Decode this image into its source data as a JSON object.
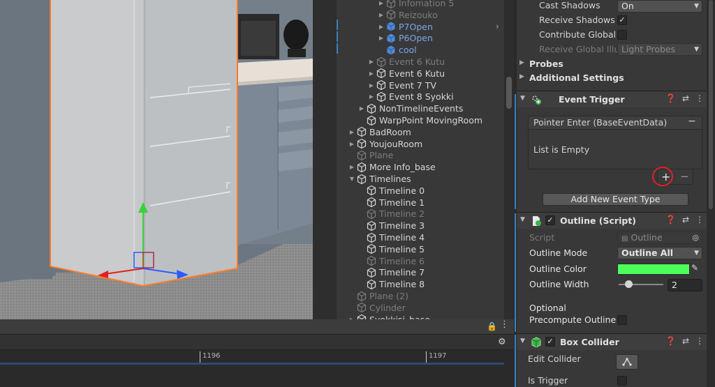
{
  "hierarchy": {
    "items": [
      {
        "label": "Infomation 5",
        "depth": 3,
        "arrow": "right",
        "state": "dim"
      },
      {
        "label": "Reizouko",
        "depth": 3,
        "arrow": "right",
        "state": "dim"
      },
      {
        "label": "P7Open",
        "depth": 3,
        "arrow": "right",
        "state": "prefab",
        "chevron": true
      },
      {
        "label": "P6Open",
        "depth": 3,
        "arrow": "right",
        "state": "prefab"
      },
      {
        "label": "cool",
        "depth": 3,
        "arrow": "",
        "state": "prefab"
      },
      {
        "label": "Event 6 Kutu",
        "depth": 2,
        "arrow": "right",
        "state": "dim"
      },
      {
        "label": "Event 6 Kutu",
        "depth": 2,
        "arrow": "right",
        "state": "normal"
      },
      {
        "label": "Event 7 TV",
        "depth": 2,
        "arrow": "right",
        "state": "normal"
      },
      {
        "label": "Event 8 Syokki",
        "depth": 2,
        "arrow": "right",
        "state": "normal"
      },
      {
        "label": "NonTimelineEvents",
        "depth": 1,
        "arrow": "right",
        "state": "normal"
      },
      {
        "label": "WarpPoint MovingRoom",
        "depth": 1,
        "arrow": "",
        "state": "normal"
      },
      {
        "label": "BadRoom",
        "depth": 0,
        "arrow": "right",
        "state": "normal"
      },
      {
        "label": "YoujouRoom",
        "depth": 0,
        "arrow": "right",
        "state": "normal"
      },
      {
        "label": "Plane",
        "depth": 0,
        "arrow": "",
        "state": "dim"
      },
      {
        "label": "More Info_base",
        "depth": 0,
        "arrow": "right",
        "state": "normal"
      },
      {
        "label": "Timelines",
        "depth": 0,
        "arrow": "down",
        "state": "normal"
      },
      {
        "label": "Timeline 0",
        "depth": 1,
        "arrow": "",
        "state": "normal"
      },
      {
        "label": "Timeline 1",
        "depth": 1,
        "arrow": "",
        "state": "normal"
      },
      {
        "label": "Timeline 2",
        "depth": 1,
        "arrow": "",
        "state": "dim"
      },
      {
        "label": "Timeline 3",
        "depth": 1,
        "arrow": "",
        "state": "normal"
      },
      {
        "label": "Timeline 4",
        "depth": 1,
        "arrow": "",
        "state": "normal"
      },
      {
        "label": "Timeline 5",
        "depth": 1,
        "arrow": "",
        "state": "normal"
      },
      {
        "label": "Timeline 6",
        "depth": 1,
        "arrow": "",
        "state": "dim"
      },
      {
        "label": "Timeline 7",
        "depth": 1,
        "arrow": "",
        "state": "normal"
      },
      {
        "label": "Timeline 8",
        "depth": 1,
        "arrow": "",
        "state": "normal"
      },
      {
        "label": "Plane (2)",
        "depth": 0,
        "arrow": "",
        "state": "dim"
      },
      {
        "label": "Cylinder",
        "depth": 0,
        "arrow": "",
        "state": "dim"
      },
      {
        "label": "Syokkisi_base",
        "depth": 0,
        "arrow": "right",
        "state": "normal"
      }
    ]
  },
  "inspector": {
    "cast_shadows": {
      "label": "Cast Shadows",
      "value": "On"
    },
    "receive_shadows": {
      "label": "Receive Shadows",
      "checked": true
    },
    "contribute_global": {
      "label": "Contribute Global",
      "checked": false
    },
    "receive_gi": {
      "label": "Receive Global Illu",
      "value": "Light Probes"
    },
    "probes": "Probes",
    "additional_settings": "Additional Settings",
    "event_trigger": {
      "title": "Event Trigger",
      "entry_header": "Pointer Enter (BaseEventData)",
      "empty_text": "List is Empty",
      "add_label": "+",
      "remove_label": "−",
      "header_remove": "−",
      "add_event_button": "Add New Event Type"
    },
    "outline": {
      "title": "Outline (Script)",
      "script_label": "Script",
      "script_value": "Outline",
      "mode_label": "Outline Mode",
      "mode_value": "Outline All",
      "color_label": "Outline Color",
      "color_value": "#4dff5a",
      "width_label": "Outline Width",
      "width_value": "2",
      "optional_label": "Optional",
      "precompute_label": "Precompute Outline",
      "precompute_checked": false
    },
    "box_collider": {
      "title": "Box Collider",
      "edit_label": "Edit Collider",
      "trigger_label": "Is Trigger",
      "trigger_checked": false
    }
  },
  "timeline": {
    "ticks": [
      "1196",
      "1197"
    ]
  },
  "colors": {
    "selection_orange": "#ff7a2a",
    "annotation_red": "#e0202a",
    "axis_green": "#3ad13a",
    "axis_red": "#e02020",
    "axis_blue": "#2a5cff"
  }
}
